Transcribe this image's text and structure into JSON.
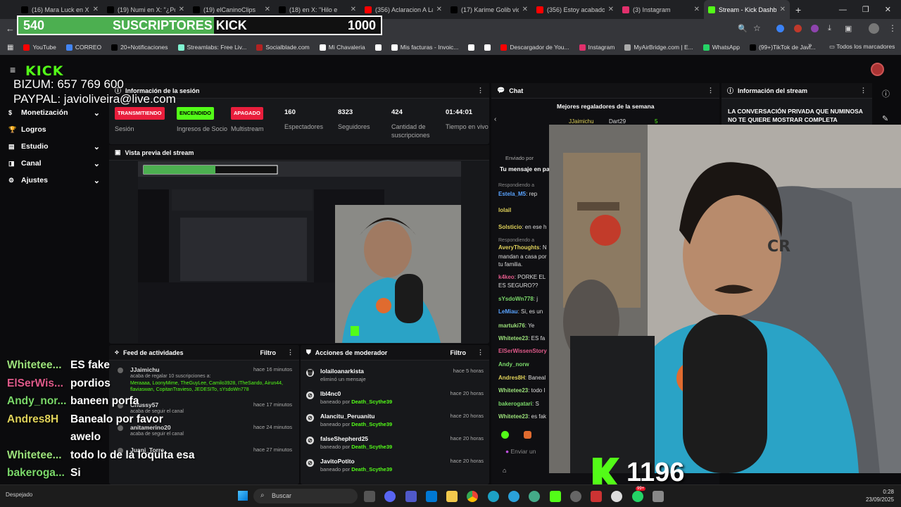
{
  "browser": {
    "tabs": [
      {
        "title": "(16) Mara Luck en X:",
        "icon": "x-icon",
        "color": "#000000"
      },
      {
        "title": "(19) Numi en X: \"¿Por",
        "icon": "x-icon",
        "color": "#000000"
      },
      {
        "title": "(19) elCaninoClips",
        "icon": "x-icon",
        "color": "#000000"
      },
      {
        "title": "(18) en X: \"Hilo e",
        "icon": "x-icon",
        "color": "#000000"
      },
      {
        "title": "(356) Aclaracion A La",
        "icon": "youtube-icon",
        "color": "#ff0000"
      },
      {
        "title": "(17) Karime Golib vio",
        "icon": "x-icon",
        "color": "#000000"
      },
      {
        "title": "(356) Estoy acabado",
        "icon": "youtube-icon",
        "color": "#ff0000"
      },
      {
        "title": "(3) Instagram",
        "icon": "instagram-icon",
        "color": "#e1306c"
      },
      {
        "title": "Stream - Kick Dashb",
        "icon": "kick-icon",
        "color": "#53fc18",
        "active": true
      }
    ],
    "bookmarks": [
      {
        "label": "YouTube",
        "color": "#ff0000"
      },
      {
        "label": "CORREO",
        "color": "#4285f4"
      },
      {
        "label": "20+Notificaciones",
        "color": "#000000"
      },
      {
        "label": "Streamlabs: Free Liv...",
        "color": "#80f5d2"
      },
      {
        "label": "Socialblade.com",
        "color": "#b22222"
      },
      {
        "label": "Mi Chavaleria",
        "color": "#ffffff"
      },
      {
        "label": "",
        "color": "#ffffff"
      },
      {
        "label": "Mis facturas - Invoic...",
        "color": "#ffffff"
      },
      {
        "label": "",
        "color": "#ffffff"
      },
      {
        "label": "",
        "color": "#ffffff"
      },
      {
        "label": "Descargador de You...",
        "color": "#ff0000"
      },
      {
        "label": "Instagram",
        "color": "#e1306c"
      },
      {
        "label": "MyAirBridge.com | E...",
        "color": "#aaaaaa"
      },
      {
        "label": "WhatsApp",
        "color": "#25d366"
      },
      {
        "label": "(99+)TikTok de Javi...",
        "color": "#000000"
      }
    ],
    "all_bookmarks": "Todos los marcadores"
  },
  "overlay": {
    "sub_current": "540",
    "sub_title": "SUSCRIPTORES KICK",
    "sub_goal": "1000",
    "sub_fraction": 0.54,
    "bizum": "BIZUM: 657 769 600",
    "paypal": "PAYPAL: javioliveira@live.com",
    "counter": "1196",
    "chat": [
      {
        "user": "Whitetee...",
        "msg": "ES fake",
        "color": "#9be07a"
      },
      {
        "user": "ElSerWis...",
        "msg": "pordios",
        "color": "#e05a8a"
      },
      {
        "user": "Andy_nor...",
        "msg": "baneen porfa",
        "color": "#7bd96a"
      },
      {
        "user": "Andres8H",
        "msg": "Banealo por favor",
        "color": "#e0d25a"
      },
      {
        "user": "",
        "msg": "awelo",
        "color": "#ffffff"
      },
      {
        "user": "Whitetee...",
        "msg": "todo lo de la loquita esa",
        "color": "#9be07a"
      },
      {
        "user": "bakeroga...",
        "msg": "Si",
        "color": "#7bd96a"
      },
      {
        "user": "Whitetee...",
        "msg": "es fake",
        "color": "#9be07a"
      }
    ]
  },
  "kick": {
    "logo": "KICK",
    "nav": [
      {
        "label": "Monetización",
        "icon": "dollar-icon",
        "chevron": true
      },
      {
        "label": "Logros",
        "icon": "trophy-icon",
        "chevron": false
      },
      {
        "label": "Estudio",
        "icon": "studio-icon",
        "chevron": true
      },
      {
        "label": "Canal",
        "icon": "channel-icon",
        "chevron": true
      },
      {
        "label": "Ajustes",
        "icon": "gear-icon",
        "chevron": true
      }
    ],
    "session": {
      "title": "Información de la sesión",
      "status": [
        {
          "badge": "TRANSMITIENDO",
          "label": "Sesión",
          "bg": "#e91e3c",
          "fg": "#ffffff"
        },
        {
          "badge": "ENCENDIDO",
          "label": "Ingresos de Socio",
          "bg": "#53fc18",
          "fg": "#000000"
        },
        {
          "badge": "APAGADO",
          "label": "Multistream",
          "bg": "#e91e3c",
          "fg": "#ffffff"
        }
      ],
      "stats": [
        {
          "value": "160",
          "label": "Espectadores"
        },
        {
          "value": "8323",
          "label": "Seguidores"
        },
        {
          "value": "424",
          "label": "Cantidad de suscripciones"
        },
        {
          "value": "01:44:01",
          "label": "Tiempo en vivo"
        }
      ]
    },
    "preview": {
      "title": "Vista previa del stream"
    },
    "activity": {
      "title": "Feed de actividades",
      "filter": "Filtro",
      "items": [
        {
          "user": "JJaimichu",
          "text": "acaba de regalar 10 suscripciones a:",
          "extra": "Meraaaa, LoonyMime, TheGuyLee, Camilo3928, ITheSando, Airun44, flaviaswan, CopitanTravieso, JEDESITo, sYsdoWn778",
          "time": "hace 16 minutos"
        },
        {
          "user": "Chussy57",
          "text": "acaba de seguir el canal",
          "extra": "",
          "time": "hace 17 minutos"
        },
        {
          "user": "anitamerino20",
          "text": "acaba de seguir el canal",
          "extra": "",
          "time": "hace 24 minutos"
        },
        {
          "user": "Juani_Torre",
          "text": "",
          "extra": "",
          "time": "hace 27 minutos"
        }
      ]
    },
    "moderator": {
      "title": "Acciones de moderador",
      "filter": "Filtro",
      "items": [
        {
          "user": "lolailoanarkista",
          "action": "eliminó un mensaje",
          "by": "",
          "time": "hace 5 horas",
          "icon": "trash-icon"
        },
        {
          "user": "lbl4nc0",
          "action": "baneado por",
          "by": "Death_Scythe39",
          "time": "hace 20 horas",
          "icon": "ban-icon"
        },
        {
          "user": "Alancitu_Peruanitu",
          "action": "baneado por",
          "by": "Death_Scythe39",
          "time": "hace 20 horas",
          "icon": "ban-icon"
        },
        {
          "user": "falseShepherd25",
          "action": "baneado por",
          "by": "Death_Scythe39",
          "time": "hace 20 horas",
          "icon": "ban-icon"
        },
        {
          "user": "JavitoPotito",
          "action": "baneado por",
          "by": "Death_Scythe39",
          "time": "hace 20 horas",
          "icon": "ban-icon"
        }
      ]
    },
    "chat": {
      "title": "Chat",
      "top_gifters": "Mejores regaladores de la semana",
      "gifters": [
        {
          "name": "JJaimichu",
          "count": ""
        },
        {
          "name": "Dart29",
          "count": "5"
        }
      ],
      "sent_by": "Enviado por",
      "pinned": "Tu mensaje en pa",
      "messages": [
        {
          "user": "Respondiendo a",
          "text": "",
          "color": "#888888"
        },
        {
          "user": "Estela_M5",
          "text": ": rep",
          "color": "#59a3ff"
        },
        {
          "user": "lolail",
          "text": "",
          "color": "#e0d25a"
        },
        {
          "user": "Solsticio",
          "text": ": en ese h",
          "color": "#e0d25a"
        },
        {
          "user": "Respondiendo a",
          "text": "",
          "color": "#888888"
        },
        {
          "user": "AveryThoughts",
          "text": ": N",
          "color": "#e0d25a"
        },
        {
          "user": "",
          "text": "mandan a casa por",
          "color": "#dddddd"
        },
        {
          "user": "",
          "text": "tu familia.",
          "color": "#dddddd"
        },
        {
          "user": "k4keo",
          "text": ": PORKE EL",
          "color": "#e05a8a"
        },
        {
          "user": "",
          "text": "ES SEGURO??",
          "color": "#dddddd"
        },
        {
          "user": "sYsdoWn778",
          "text": ": j",
          "color": "#7bd96a"
        },
        {
          "user": "LeMiau",
          "text": ": Si, es un",
          "color": "#59a3ff"
        },
        {
          "user": "martuki76",
          "text": ": Ye",
          "color": "#9be07a"
        },
        {
          "user": "Whitetee23",
          "text": ": ES fa",
          "color": "#9be07a"
        },
        {
          "user": "ElSerWissenStory",
          "text": "",
          "color": "#e05a8a"
        },
        {
          "user": "Andy_norw",
          "text": "",
          "color": "#7bd96a"
        },
        {
          "user": "Andres8H",
          "text": ": Baneal",
          "color": "#e0d25a"
        },
        {
          "user": "Whitetee23",
          "text": ": todo l",
          "color": "#9be07a"
        },
        {
          "user": "bakerogatari",
          "text": ": S",
          "color": "#7bd96a"
        },
        {
          "user": "Whitetee23",
          "text": ": es fak",
          "color": "#9be07a"
        }
      ],
      "input_placeholder": "Enviar un"
    },
    "stream_info": {
      "title": "Información del stream",
      "text": "LA CONVERSACIÓN PRIVADA QUE NUMINOSA NO TE QUIERE MOSTRAR COMPLETA"
    }
  },
  "taskbar": {
    "search": "Buscar",
    "time": "0:28",
    "date": "23/09/2025",
    "weather": "Despejado",
    "badge": "99+"
  }
}
